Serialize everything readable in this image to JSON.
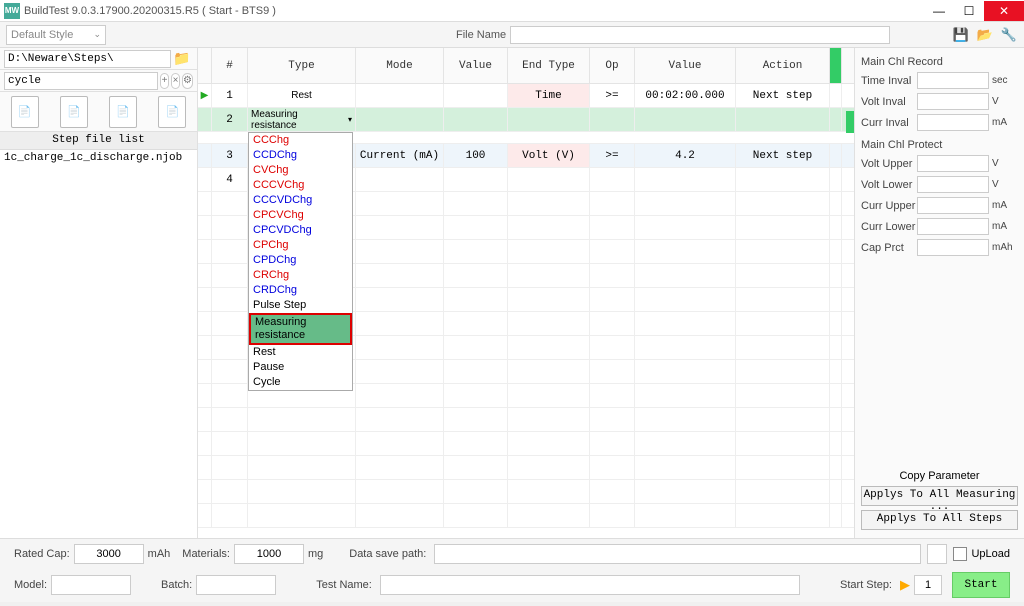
{
  "titlebar": {
    "app_icon": "MW",
    "title": "BuildTest  9.0.3.17900.20200315.R5 ( Start - BTS9 )"
  },
  "toolbar": {
    "style_label": "Default Style",
    "filename_label": "File Name"
  },
  "left": {
    "path": "D:\\Neware\\Steps\\",
    "cycle": "cycle",
    "step_file_list": "Step file list",
    "files": [
      "1c_charge_1c_discharge.njob"
    ]
  },
  "grid": {
    "headers": {
      "num": "#",
      "type": "Type",
      "mode": "Mode",
      "value1": "Value",
      "end": "End Type",
      "op": "Op",
      "value2": "Value",
      "action": "Action"
    },
    "rows": [
      {
        "num": "1",
        "type": "Rest",
        "mode": "",
        "value1": "",
        "end": "Time",
        "op": ">=",
        "value2": "00:02:00.000",
        "action": "Next step",
        "play": true
      },
      {
        "num": "2",
        "type": "Measuring resistance",
        "active": true
      },
      {
        "num": "3",
        "type": "",
        "mode": "Current (mA)",
        "value1": "100",
        "end": "Volt (V)",
        "op": ">=",
        "value2": "4.2",
        "action": "Next step",
        "blue": true
      },
      {
        "num": "4",
        "type": ""
      }
    ]
  },
  "type_options": [
    {
      "label": "CCChg",
      "cls": "red"
    },
    {
      "label": "CCDChg",
      "cls": "blue"
    },
    {
      "label": "CVChg",
      "cls": "red"
    },
    {
      "label": "CCCVChg",
      "cls": "red"
    },
    {
      "label": "CCCVDChg",
      "cls": "blue"
    },
    {
      "label": "CPCVChg",
      "cls": "red"
    },
    {
      "label": "CPCVDChg",
      "cls": "blue"
    },
    {
      "label": "CPChg",
      "cls": "red"
    },
    {
      "label": "CPDChg",
      "cls": "blue"
    },
    {
      "label": "CRChg",
      "cls": "red"
    },
    {
      "label": "CRDChg",
      "cls": "blue"
    },
    {
      "label": "Pulse Step",
      "cls": ""
    },
    {
      "label": "Measuring resistance",
      "cls": "sel"
    },
    {
      "label": "Rest",
      "cls": ""
    },
    {
      "label": "Pause",
      "cls": ""
    },
    {
      "label": "Cycle",
      "cls": ""
    }
  ],
  "right": {
    "record_header": "Main Chl Record",
    "protect_header": "Main Chl Protect",
    "fields": {
      "time_inval": "Time Inval",
      "volt_inval": "Volt Inval",
      "curr_inval": "Curr Inval",
      "volt_upper": "Volt Upper",
      "volt_lower": "Volt Lower",
      "curr_upper": "Curr Upper",
      "curr_lower": "Curr Lower",
      "cap_prct": "Cap Prct"
    },
    "units": {
      "sec": "sec",
      "v": "V",
      "ma": "mA",
      "mah": "mAh"
    },
    "copy_param": "Copy Parameter",
    "apply_measuring": "Applys To All Measuring ...",
    "apply_steps": "Applys To All Steps"
  },
  "bottom": {
    "rated_cap": "Rated Cap:",
    "rated_cap_val": "3000",
    "mah": "mAh",
    "materials": "Materials:",
    "materials_val": "1000",
    "mg": "mg",
    "data_save": "Data save path:",
    "upload": "UpLoad",
    "model": "Model:",
    "batch": "Batch:",
    "test_name": "Test Name:",
    "start_step": "Start Step:",
    "start_step_val": "1",
    "start": "Start"
  }
}
